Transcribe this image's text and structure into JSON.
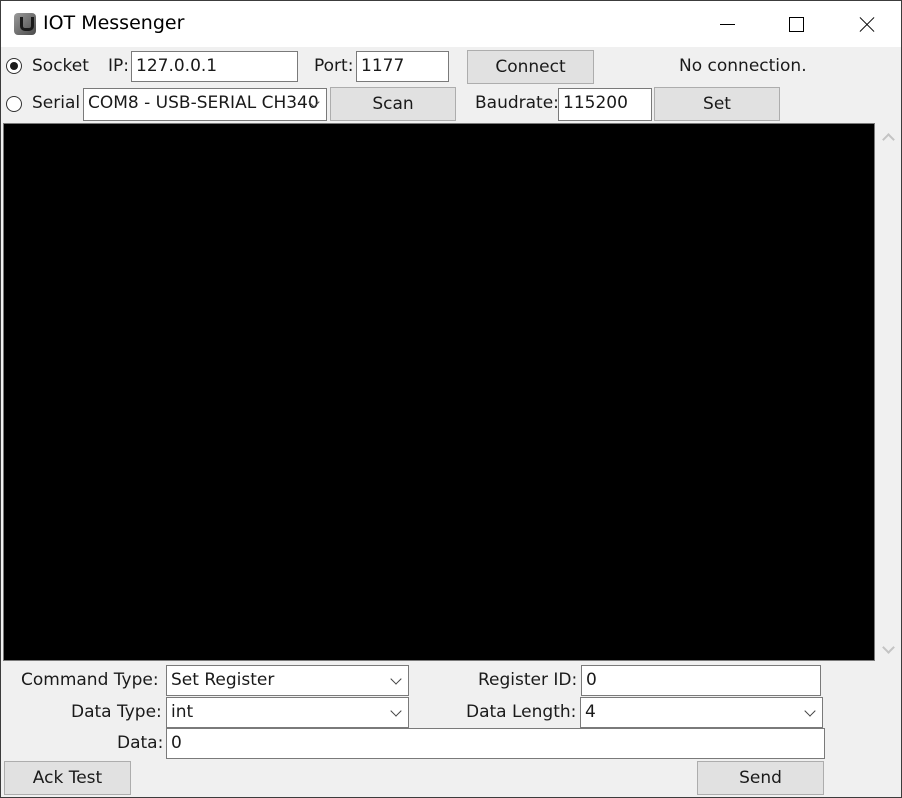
{
  "window": {
    "title": "IOT Messenger",
    "icon": "app-logo-icon",
    "controls": [
      "minimize-icon",
      "maximize-icon",
      "close-icon"
    ]
  },
  "connection": {
    "socket_label": "Socket",
    "socket_selected": true,
    "ip_label": "IP:",
    "ip_value": "127.0.0.1",
    "port_label": "Port:",
    "port_value": "1177",
    "connect_label": "Connect",
    "status": "No connection.",
    "serial_label": "Serial",
    "serial_selected": false,
    "com_port_value": "COM8 - USB-SERIAL CH340",
    "scan_label": "Scan",
    "baudrate_label": "Baudrate:",
    "baudrate_value": "115200",
    "set_label": "Set"
  },
  "console": {
    "content": ""
  },
  "command": {
    "command_type_label": "Command Type:",
    "command_type_value": "Set Register",
    "register_id_label": "Register ID:",
    "register_id_value": "0",
    "data_type_label": "Data Type:",
    "data_type_value": "int",
    "data_length_label": "Data Length:",
    "data_length_value": "4",
    "data_label": "Data:",
    "data_value": "0",
    "ack_test_label": "Ack Test",
    "send_label": "Send"
  }
}
